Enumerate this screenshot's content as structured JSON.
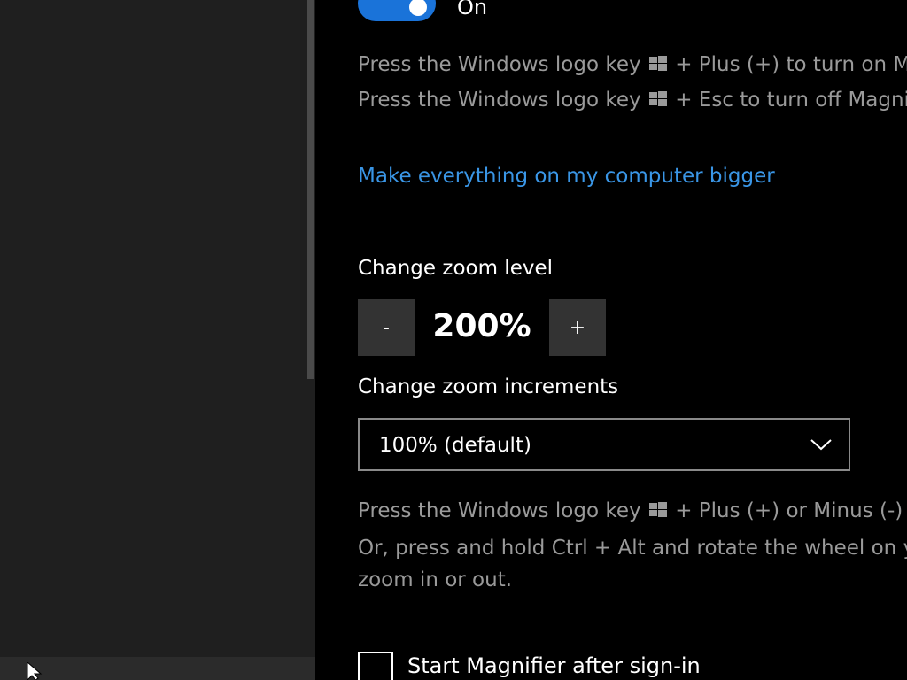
{
  "magnifier": {
    "toggle_state": "On",
    "toggle_on": true,
    "hint_on": [
      "Press the Windows logo key",
      "+ Plus (+) to turn on Magnifier."
    ],
    "hint_off": [
      "Press the Windows logo key",
      "+ Esc to turn off Magnifier."
    ],
    "bigger_link": "Make everything on my computer bigger",
    "zoom_level_label": "Change zoom level",
    "zoom_minus": "-",
    "zoom_value": "200%",
    "zoom_plus": "+",
    "increments_label": "Change zoom increments",
    "increments_selected": "100% (default)",
    "zoom_hint_1": [
      "Press the Windows logo key",
      "+ Plus (+) or Minus (-) to zoom in or out."
    ],
    "zoom_hint_2": "Or, press and hold Ctrl + Alt and rotate the wheel on your mouse to",
    "zoom_hint_3": "zoom in or out.",
    "start_after_signin_label": "Start Magnifier after sign-in",
    "start_after_signin_checked": false
  },
  "colors": {
    "accent": "#1a73d9",
    "link": "#3a96e6",
    "hint_text": "#9a9a9a",
    "nav_background": "#1f1f1f",
    "content_background": "#000000"
  },
  "icons": {
    "windows_logo": "windows-logo-icon",
    "dropdown": "chevron-down-icon",
    "cursor": "mouse-pointer-icon"
  }
}
